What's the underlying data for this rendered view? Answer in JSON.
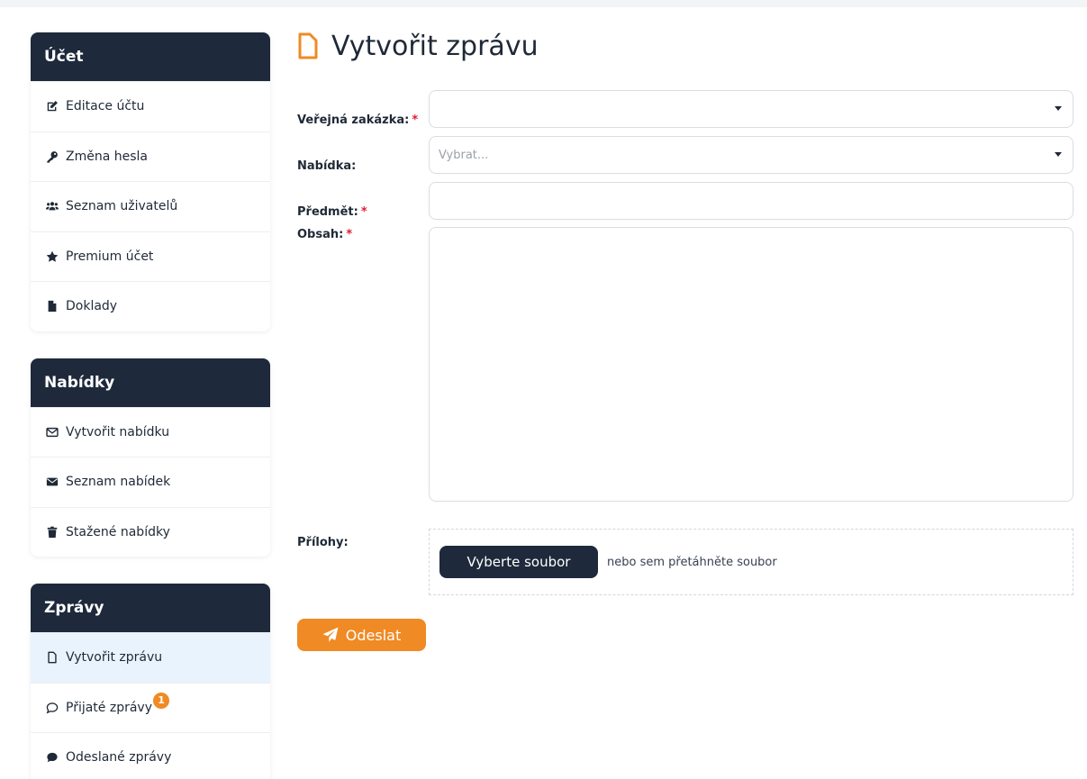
{
  "sidebar": {
    "account": {
      "title": "Účet",
      "items": [
        {
          "label": "Editace účtu",
          "icon": "edit-icon"
        },
        {
          "label": "Změna hesla",
          "icon": "key-icon"
        },
        {
          "label": "Seznam uživatelů",
          "icon": "users-icon"
        },
        {
          "label": "Premium účet",
          "icon": "star-icon"
        },
        {
          "label": "Doklady",
          "icon": "file-icon"
        }
      ]
    },
    "offers": {
      "title": "Nabídky",
      "items": [
        {
          "label": "Vytvořit nabídku",
          "icon": "envelope-outline-icon"
        },
        {
          "label": "Seznam nabídek",
          "icon": "envelope-icon"
        },
        {
          "label": "Stažené nabídky",
          "icon": "trash-icon"
        }
      ]
    },
    "messages": {
      "title": "Zprávy",
      "items": [
        {
          "label": "Vytvořit zprávu",
          "icon": "file-outline-icon",
          "active": true
        },
        {
          "label": "Přijaté zprávy",
          "icon": "comment-outline-icon",
          "badge": "1"
        },
        {
          "label": "Odeslané zprávy",
          "icon": "comment-icon"
        }
      ]
    }
  },
  "main": {
    "title": "Vytvořit zprávu",
    "form": {
      "tender_label": "Veřejná zakázka:",
      "offer_label": "Nabídka:",
      "offer_placeholder": "Vybrat...",
      "subject_label": "Předmět:",
      "content_label": "Obsah:",
      "attachments_label": "Přílohy:",
      "required_mark": "*",
      "file_button": "Vyberte soubor",
      "drop_text": "nebo sem přetáhněte soubor",
      "submit_label": "Odeslat"
    }
  },
  "colors": {
    "navy": "#1e2a3b",
    "accent": "#f08a24",
    "active_bg": "#e8f3fd",
    "required": "#e11d2e"
  }
}
